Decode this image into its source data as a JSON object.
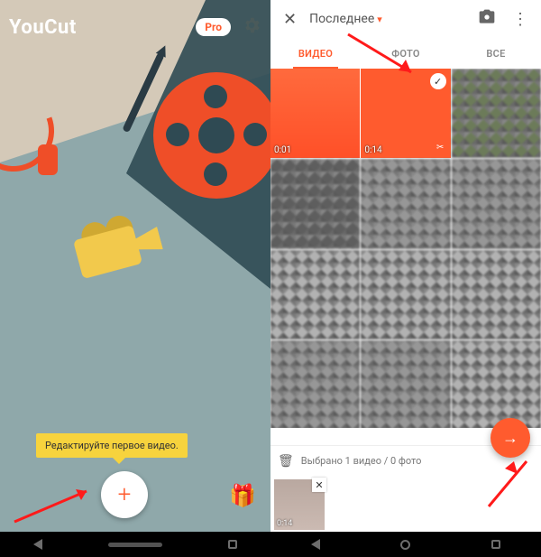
{
  "left": {
    "app_name": "YouCut",
    "pro_label": "Pro",
    "tooltip": "Редактируйте первое видео.",
    "add_glyph": "+",
    "gift_glyph": "🎁"
  },
  "right": {
    "close_glyph": "✕",
    "folder_title": "Последнее",
    "dropdown_glyph": "▾",
    "more_glyph": "⋮",
    "tabs": {
      "video": "ВИДЕО",
      "photo": "ФОТО",
      "all": "ВСЕ"
    },
    "thumbs": [
      {
        "dur": "0:01"
      },
      {
        "dur": "0:14",
        "selected": true,
        "cut": true
      },
      {},
      {},
      {},
      {},
      {},
      {},
      {},
      {},
      {},
      {}
    ],
    "selection_text": "Выбрано 1 видео / 0 фото",
    "trash_glyph": "🗑",
    "selected_clip": {
      "dur": "0:14",
      "remove_glyph": "✕"
    },
    "next_glyph": "→"
  },
  "colors": {
    "accent": "#ff5b2e"
  }
}
